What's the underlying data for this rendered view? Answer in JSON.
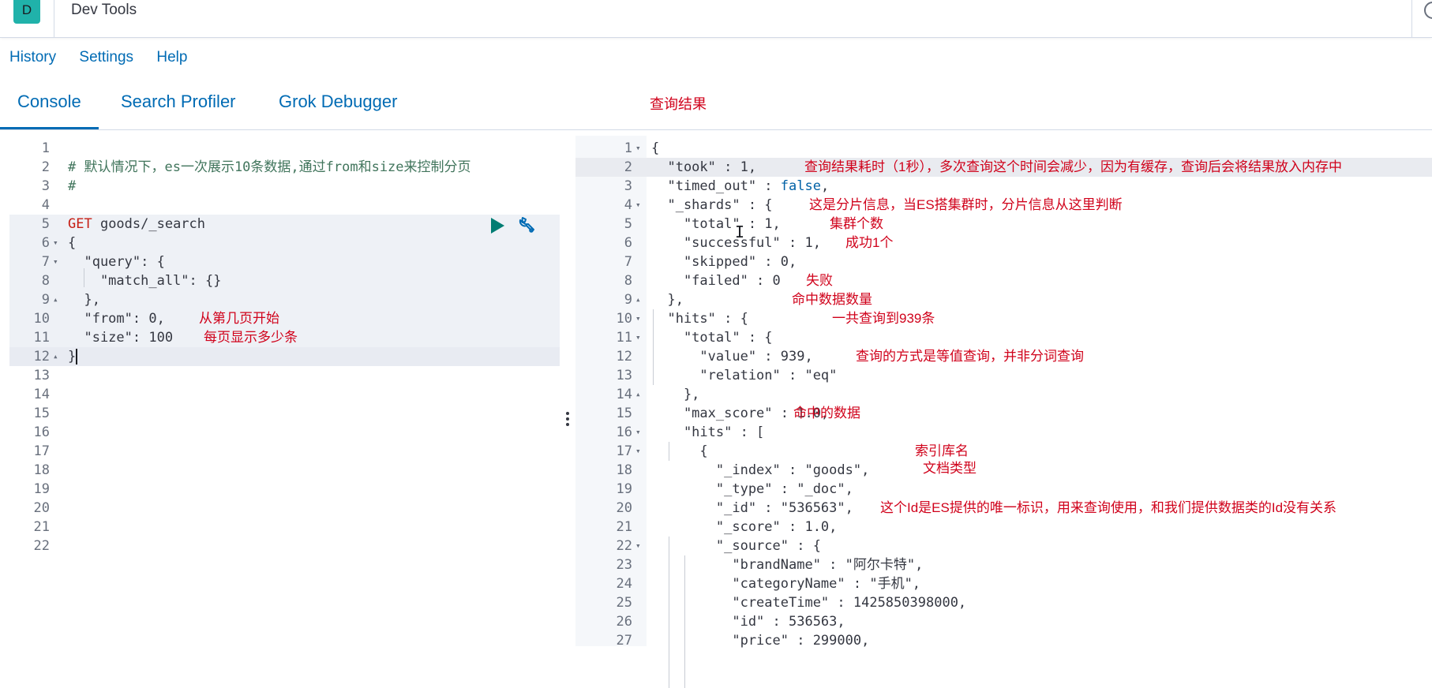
{
  "header": {
    "logo_letter": "D",
    "title": "Dev Tools"
  },
  "menu": [
    "History",
    "Settings",
    "Help"
  ],
  "tabs": [
    "Console",
    "Search Profiler",
    "Grok Debugger"
  ],
  "tab_note": "查询结果",
  "editor": {
    "lines": [
      {
        "n": "1",
        "text": ""
      },
      {
        "n": "2",
        "text": "# 默认情况下，es一次展示10条数据,通过from和size来控制分页"
      },
      {
        "n": "3",
        "text": "#"
      },
      {
        "n": "4",
        "text": ""
      },
      {
        "n": "5",
        "method": "GET",
        "path": " goods/_search"
      },
      {
        "n": "6",
        "text": "{"
      },
      {
        "n": "7",
        "text": "  \"query\": {"
      },
      {
        "n": "8",
        "text": "    \"match_all\": {}"
      },
      {
        "n": "9",
        "text": "  },"
      },
      {
        "n": "10",
        "text": "  \"from\": 0,"
      },
      {
        "n": "11",
        "text": "  \"size\": 100"
      },
      {
        "n": "12",
        "text": "}"
      },
      {
        "n": "13",
        "text": ""
      },
      {
        "n": "14",
        "text": ""
      },
      {
        "n": "15",
        "text": ""
      },
      {
        "n": "16",
        "text": ""
      },
      {
        "n": "17",
        "text": ""
      },
      {
        "n": "18",
        "text": ""
      },
      {
        "n": "19",
        "text": ""
      },
      {
        "n": "20",
        "text": ""
      },
      {
        "n": "21",
        "text": ""
      },
      {
        "n": "22",
        "text": ""
      }
    ],
    "notes": {
      "from": "从第几页开始",
      "size": "每页显示多少条"
    }
  },
  "output": {
    "lines": [
      {
        "n": "1",
        "text": "{"
      },
      {
        "n": "2",
        "text": "  \"took\" : 1,"
      },
      {
        "n": "3",
        "text": "  \"timed_out\" : ",
        "val": "false",
        "tail": ","
      },
      {
        "n": "4",
        "text": "  \"_shards\" : {"
      },
      {
        "n": "5",
        "text": "    \"total\" : 1,"
      },
      {
        "n": "6",
        "text": "    \"successful\" : 1,"
      },
      {
        "n": "7",
        "text": "    \"skipped\" : 0,"
      },
      {
        "n": "8",
        "text": "    \"failed\" : 0"
      },
      {
        "n": "9",
        "text": "  },"
      },
      {
        "n": "10",
        "text": "  \"hits\" : {"
      },
      {
        "n": "11",
        "text": "    \"total\" : {"
      },
      {
        "n": "12",
        "text": "      \"value\" : 939,"
      },
      {
        "n": "13",
        "text": "      \"relation\" : \"eq\""
      },
      {
        "n": "14",
        "text": "    },"
      },
      {
        "n": "15",
        "text": "    \"max_score\" : 1.0,"
      },
      {
        "n": "16",
        "text": "    \"hits\" : ["
      },
      {
        "n": "17",
        "text": "      {"
      },
      {
        "n": "18",
        "text": "        \"_index\" : \"goods\","
      },
      {
        "n": "19",
        "text": "        \"_type\" : \"_doc\","
      },
      {
        "n": "20",
        "text": "        \"_id\" : \"536563\","
      },
      {
        "n": "21",
        "text": "        \"_score\" : 1.0,"
      },
      {
        "n": "22",
        "text": "        \"_source\" : {"
      },
      {
        "n": "23",
        "text": "          \"brandName\" : \"阿尔卡特\","
      },
      {
        "n": "24",
        "text": "          \"categoryName\" : \"手机\","
      },
      {
        "n": "25",
        "text": "          \"createTime\" : 1425850398000,"
      },
      {
        "n": "26",
        "text": "          \"id\" : 536563,"
      },
      {
        "n": "27",
        "text": "          \"price\" : 299000,"
      }
    ],
    "notes": {
      "took": "查询结果耗时（1秒），多次查询这个时间会减少，因为有缓存，查询后会将结果放入内存中",
      "shards": "这是分片信息，当ES搭集群时，分片信息从这里判断",
      "total": "集群个数",
      "successful": "成功1个",
      "failed": "失败",
      "hits": "命中数据数量",
      "value": "一共查询到939条",
      "relation": "查询的方式是等值查询，并非分词查询",
      "hits_arr": "命中的数据",
      "index": "索引库名",
      "type": "文档类型",
      "id": "这个Id是ES提供的唯一标识，用来查询使用，和我们提供数据类的Id没有关系"
    }
  }
}
